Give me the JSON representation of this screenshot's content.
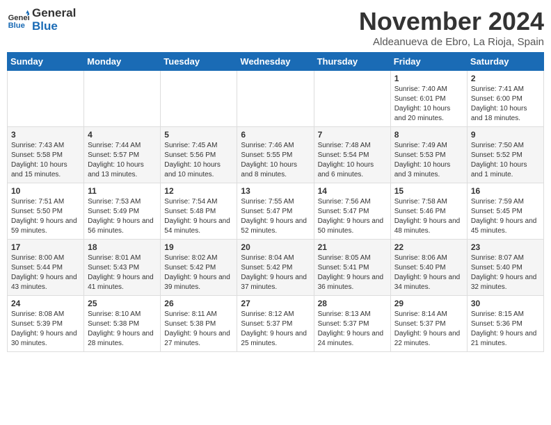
{
  "header": {
    "logo_line1": "General",
    "logo_line2": "Blue",
    "month": "November 2024",
    "location": "Aldeanueva de Ebro, La Rioja, Spain"
  },
  "weekdays": [
    "Sunday",
    "Monday",
    "Tuesday",
    "Wednesday",
    "Thursday",
    "Friday",
    "Saturday"
  ],
  "weeks": [
    [
      {
        "day": "",
        "info": ""
      },
      {
        "day": "",
        "info": ""
      },
      {
        "day": "",
        "info": ""
      },
      {
        "day": "",
        "info": ""
      },
      {
        "day": "",
        "info": ""
      },
      {
        "day": "1",
        "info": "Sunrise: 7:40 AM\nSunset: 6:01 PM\nDaylight: 10 hours and 20 minutes."
      },
      {
        "day": "2",
        "info": "Sunrise: 7:41 AM\nSunset: 6:00 PM\nDaylight: 10 hours and 18 minutes."
      }
    ],
    [
      {
        "day": "3",
        "info": "Sunrise: 7:43 AM\nSunset: 5:58 PM\nDaylight: 10 hours and 15 minutes."
      },
      {
        "day": "4",
        "info": "Sunrise: 7:44 AM\nSunset: 5:57 PM\nDaylight: 10 hours and 13 minutes."
      },
      {
        "day": "5",
        "info": "Sunrise: 7:45 AM\nSunset: 5:56 PM\nDaylight: 10 hours and 10 minutes."
      },
      {
        "day": "6",
        "info": "Sunrise: 7:46 AM\nSunset: 5:55 PM\nDaylight: 10 hours and 8 minutes."
      },
      {
        "day": "7",
        "info": "Sunrise: 7:48 AM\nSunset: 5:54 PM\nDaylight: 10 hours and 6 minutes."
      },
      {
        "day": "8",
        "info": "Sunrise: 7:49 AM\nSunset: 5:53 PM\nDaylight: 10 hours and 3 minutes."
      },
      {
        "day": "9",
        "info": "Sunrise: 7:50 AM\nSunset: 5:52 PM\nDaylight: 10 hours and 1 minute."
      }
    ],
    [
      {
        "day": "10",
        "info": "Sunrise: 7:51 AM\nSunset: 5:50 PM\nDaylight: 9 hours and 59 minutes."
      },
      {
        "day": "11",
        "info": "Sunrise: 7:53 AM\nSunset: 5:49 PM\nDaylight: 9 hours and 56 minutes."
      },
      {
        "day": "12",
        "info": "Sunrise: 7:54 AM\nSunset: 5:48 PM\nDaylight: 9 hours and 54 minutes."
      },
      {
        "day": "13",
        "info": "Sunrise: 7:55 AM\nSunset: 5:47 PM\nDaylight: 9 hours and 52 minutes."
      },
      {
        "day": "14",
        "info": "Sunrise: 7:56 AM\nSunset: 5:47 PM\nDaylight: 9 hours and 50 minutes."
      },
      {
        "day": "15",
        "info": "Sunrise: 7:58 AM\nSunset: 5:46 PM\nDaylight: 9 hours and 48 minutes."
      },
      {
        "day": "16",
        "info": "Sunrise: 7:59 AM\nSunset: 5:45 PM\nDaylight: 9 hours and 45 minutes."
      }
    ],
    [
      {
        "day": "17",
        "info": "Sunrise: 8:00 AM\nSunset: 5:44 PM\nDaylight: 9 hours and 43 minutes."
      },
      {
        "day": "18",
        "info": "Sunrise: 8:01 AM\nSunset: 5:43 PM\nDaylight: 9 hours and 41 minutes."
      },
      {
        "day": "19",
        "info": "Sunrise: 8:02 AM\nSunset: 5:42 PM\nDaylight: 9 hours and 39 minutes."
      },
      {
        "day": "20",
        "info": "Sunrise: 8:04 AM\nSunset: 5:42 PM\nDaylight: 9 hours and 37 minutes."
      },
      {
        "day": "21",
        "info": "Sunrise: 8:05 AM\nSunset: 5:41 PM\nDaylight: 9 hours and 36 minutes."
      },
      {
        "day": "22",
        "info": "Sunrise: 8:06 AM\nSunset: 5:40 PM\nDaylight: 9 hours and 34 minutes."
      },
      {
        "day": "23",
        "info": "Sunrise: 8:07 AM\nSunset: 5:40 PM\nDaylight: 9 hours and 32 minutes."
      }
    ],
    [
      {
        "day": "24",
        "info": "Sunrise: 8:08 AM\nSunset: 5:39 PM\nDaylight: 9 hours and 30 minutes."
      },
      {
        "day": "25",
        "info": "Sunrise: 8:10 AM\nSunset: 5:38 PM\nDaylight: 9 hours and 28 minutes."
      },
      {
        "day": "26",
        "info": "Sunrise: 8:11 AM\nSunset: 5:38 PM\nDaylight: 9 hours and 27 minutes."
      },
      {
        "day": "27",
        "info": "Sunrise: 8:12 AM\nSunset: 5:37 PM\nDaylight: 9 hours and 25 minutes."
      },
      {
        "day": "28",
        "info": "Sunrise: 8:13 AM\nSunset: 5:37 PM\nDaylight: 9 hours and 24 minutes."
      },
      {
        "day": "29",
        "info": "Sunrise: 8:14 AM\nSunset: 5:37 PM\nDaylight: 9 hours and 22 minutes."
      },
      {
        "day": "30",
        "info": "Sunrise: 8:15 AM\nSunset: 5:36 PM\nDaylight: 9 hours and 21 minutes."
      }
    ]
  ]
}
